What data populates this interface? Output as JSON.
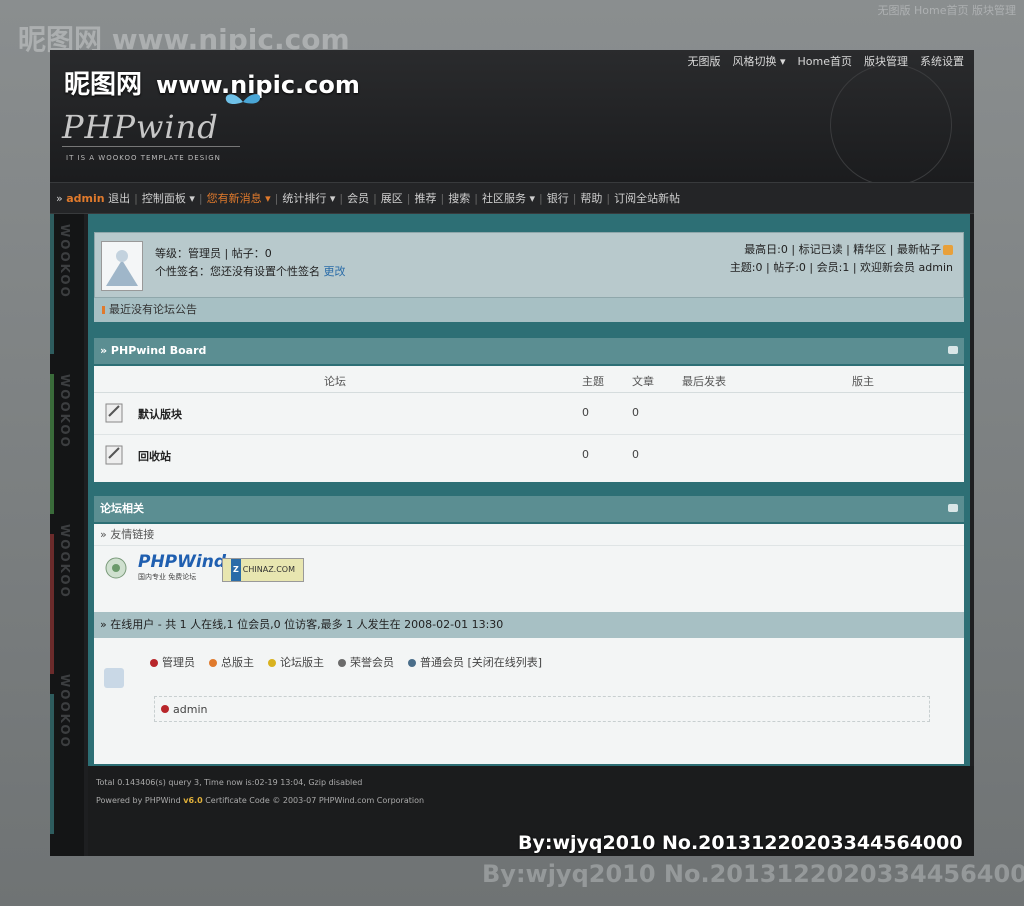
{
  "watermark": {
    "site": "昵图网",
    "url": "www.nipic.com"
  },
  "top_nav": [
    "无图版",
    "风格切换 ▾",
    "Home首页",
    "版块管理",
    "系统设置"
  ],
  "logo": {
    "title": "PHPwind",
    "tagline": "IT IS A WOOKOO TEMPLATE DESIGN"
  },
  "sidebar_text": "WOOKOO",
  "main_nav": {
    "user": "admin",
    "items": [
      "退出",
      "控制面板 ▾",
      "您有新消息 ▾",
      "统计排行 ▾",
      "会员",
      "展区",
      "推荐",
      "搜索",
      "社区服务 ▾",
      "银行",
      "帮助",
      "订阅全站新帖"
    ]
  },
  "user_info": {
    "level_line": "等级：管理员 | 帖子：0",
    "signature": "个性签名：您还没有设置个性签名",
    "signature_link": "更改",
    "stats_line1": "最高日:0 | 标记已读 | 精华区 | 最新帖子",
    "stats_line2": "主题:0 | 帖子:0 | 会员:1 | 欢迎新会员 admin"
  },
  "announcement": "最近没有论坛公告",
  "board": {
    "title": "» PHPwind Board",
    "columns": [
      "论坛",
      "主题",
      "文章",
      "最后发表",
      "版主"
    ],
    "forums": [
      {
        "name": "默认版块",
        "topics": "0",
        "posts": "0"
      },
      {
        "name": "回收站",
        "topics": "0",
        "posts": "0"
      }
    ]
  },
  "related": {
    "title": "论坛相关",
    "links_label": "» 友情链接",
    "phpwind_logo": "PHPWind",
    "phpwind_sub": "国内专业 免费论坛",
    "chinaz_logo": "CHINAZ.COM",
    "online_line": "» 在线用户 - 共 1 人在线,1 位会员,0 位访客,最多 1 人发生在 2008-02-01 13:30",
    "legend": [
      {
        "label": "管理员",
        "color": "#b8262a"
      },
      {
        "label": "总版主",
        "color": "#e07a2c"
      },
      {
        "label": "论坛版主",
        "color": "#d9b21f"
      },
      {
        "label": "荣誉会员",
        "color": "#6b6b6b"
      },
      {
        "label": "普通会员 [关闭在线列表]",
        "color": "#4a6e8a"
      }
    ],
    "online_user": "admin"
  },
  "footer": {
    "line1": "Total 0.143406(s) query 3, Time now is:02-19 13:04, Gzip disabled",
    "powered_prefix": "Powered by",
    "powered_brand": "PHPWind",
    "version": "v6.0",
    "cert": "Certificate",
    "code": "Code © 2003-07",
    "company": "PHPWind.com",
    "corp": "Corporation"
  },
  "credit": "By:wjyq2010  No.20131220203344564000"
}
